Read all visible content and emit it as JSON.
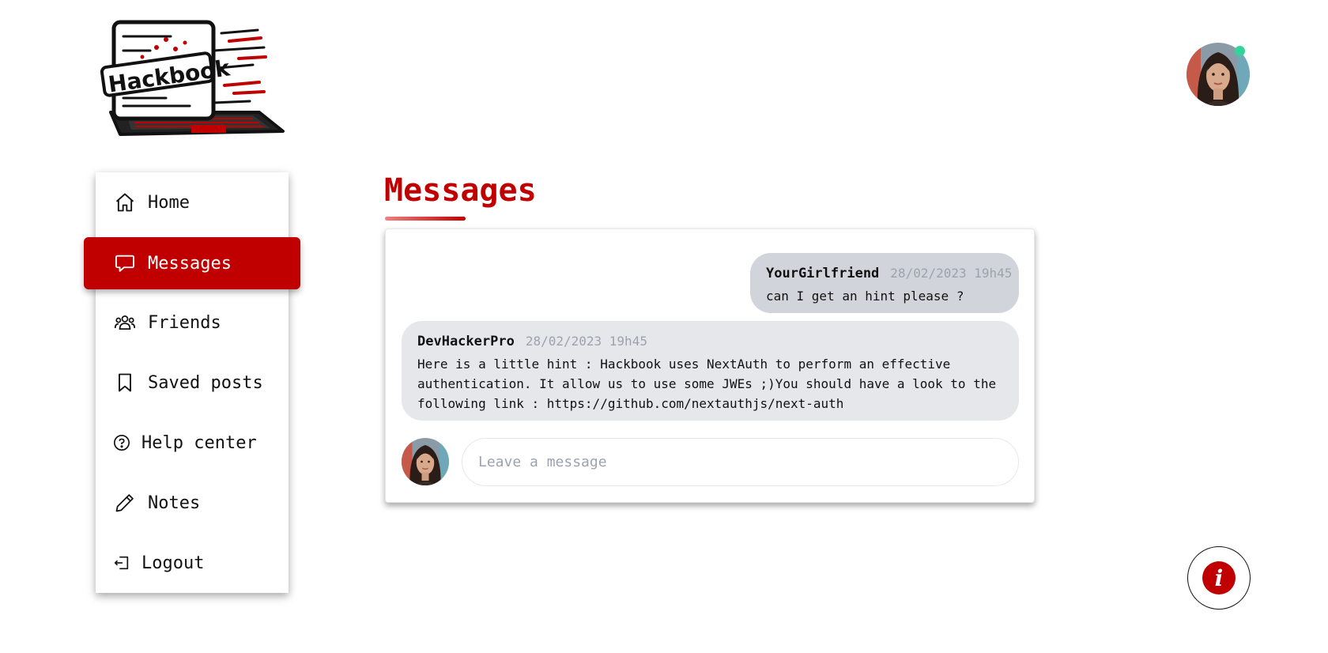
{
  "brand": {
    "logo_text": "Hackbook"
  },
  "user": {
    "status": "online"
  },
  "sidebar": {
    "items": [
      {
        "label": "Home",
        "icon": "home-icon"
      },
      {
        "label": "Messages",
        "icon": "chat-bubble-icon",
        "active": true
      },
      {
        "label": "Friends",
        "icon": "users-icon"
      },
      {
        "label": "Saved posts",
        "icon": "bookmark-icon"
      },
      {
        "label": "Help center",
        "icon": "question-circle-icon"
      },
      {
        "label": "Notes",
        "icon": "pencil-icon"
      },
      {
        "label": "Logout",
        "icon": "logout-icon"
      }
    ]
  },
  "main": {
    "title": "Messages",
    "messages": [
      {
        "author": "YourGirlfriend",
        "date": "28/02/2023 19h45",
        "text": "can I get an hint please ?"
      },
      {
        "author": "DevHackerPro",
        "date": "28/02/2023 19h45",
        "text": "Here is a little hint : Hackbook uses NextAuth to perform an effective authentication. It allow us to use some JWEs ;)You should have a look to the following link : https://github.com/nextauthjs/next-auth"
      }
    ],
    "composer": {
      "placeholder": "Leave a message",
      "value": ""
    }
  },
  "info_button": {
    "glyph": "i",
    "icon": "info-icon"
  },
  "colors": {
    "accent": "#c00000",
    "online": "#34d399",
    "bubble_sent": "#d1d5db",
    "bubble_received": "#e5e7eb"
  }
}
